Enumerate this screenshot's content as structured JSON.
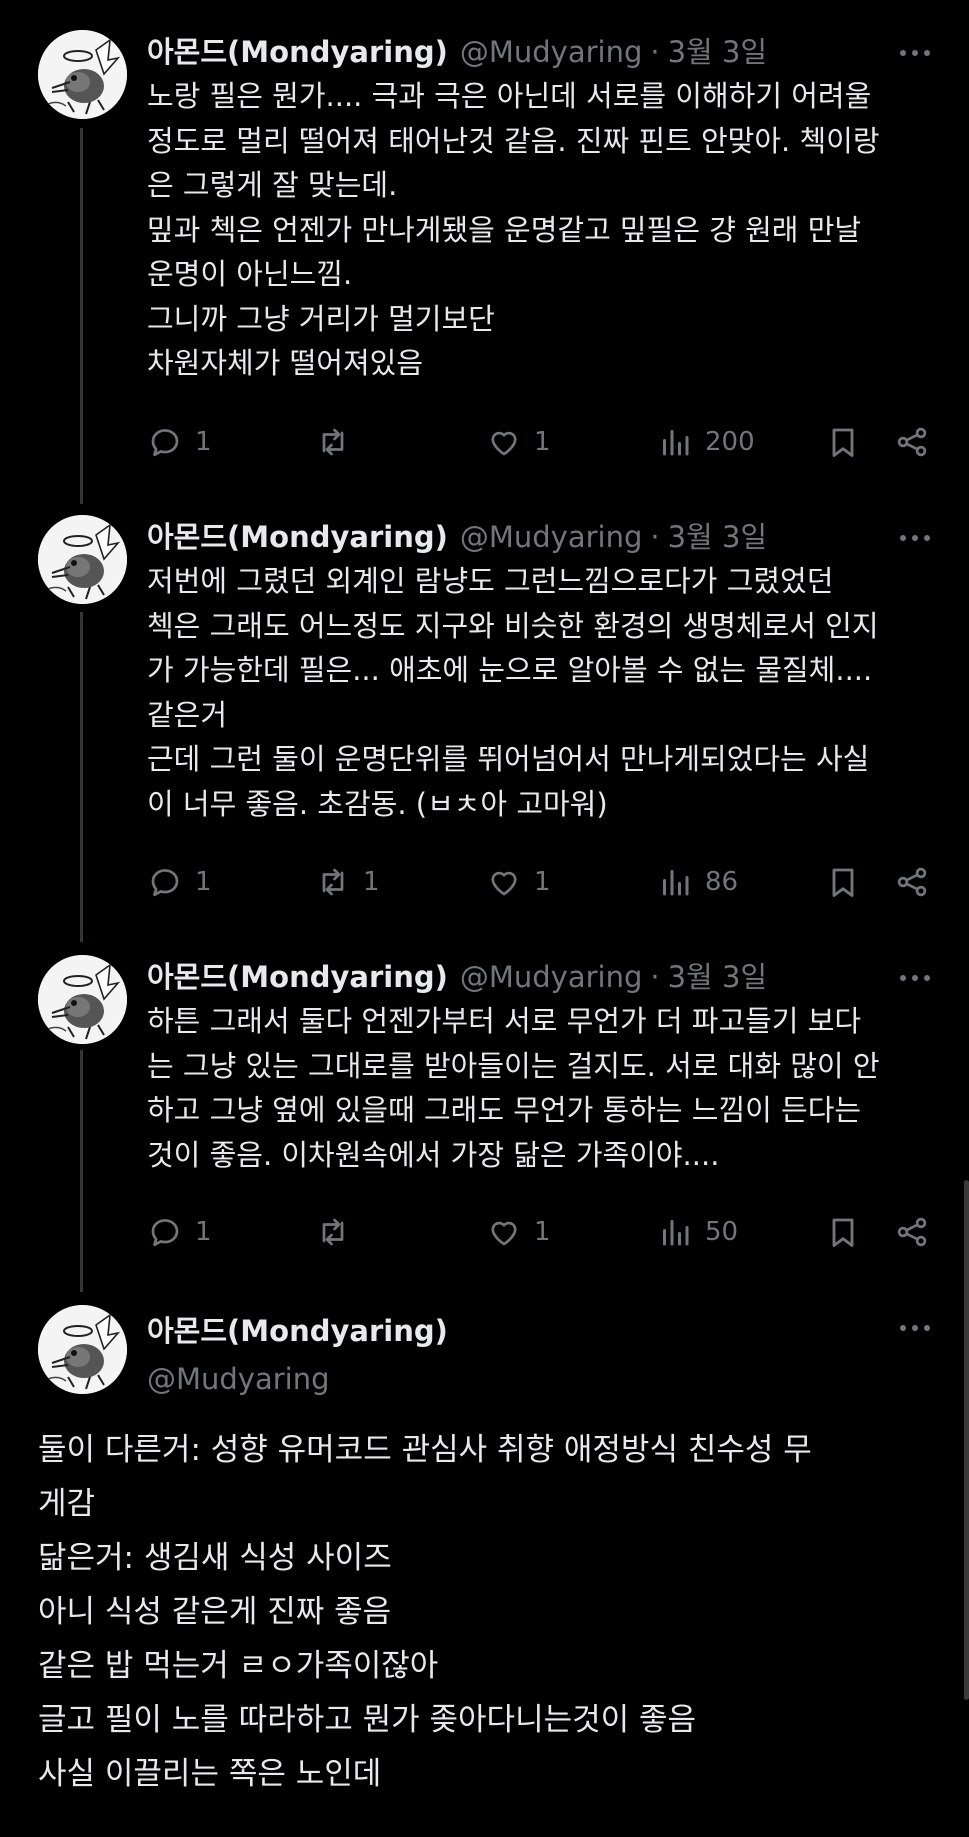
{
  "author": {
    "name": "아몬드(Mondyaring)",
    "handle": "@Mudyaring"
  },
  "tweets": [
    {
      "date": "3월 3일",
      "lines": [
        "노랑 필은 뭔가.... 극과 극은 아닌데 서로를 이해하기 어려울",
        "정도로 멀리 떨어져 태어난것 같음. 진짜 핀트 안맞아. 첵이랑",
        "은 그렇게 잘 맞는데.",
        "밒과 첵은 언젠가 만나게됐을 운명같고 밒필은 걍 원래 만날",
        "운명이 아닌느낌.",
        "그니까 그냥 거리가 멀기보단",
        "차원자체가 떨어져있음"
      ],
      "replies": "1",
      "reposts": "",
      "likes": "1",
      "views": "200"
    },
    {
      "date": "3월 3일",
      "lines": [
        "저번에 그렸던 외계인 람냥도 그런느낌으로다가 그렸었던",
        "첵은 그래도 어느정도 지구와 비슷한 환경의 생명체로서 인지",
        "가 가능한데 필은... 애초에 눈으로 알아볼 수 없는 물질체....",
        "같은거",
        "근데 그런 둘이 운명단위를 뛰어넘어서 만나게되었다는 사실",
        "이 너무 좋음. 초감동. (ㅂㅊ아 고마워)"
      ],
      "replies": "1",
      "reposts": "1",
      "likes": "1",
      "views": "86"
    },
    {
      "date": "3월 3일",
      "lines": [
        "하튼 그래서 둘다 언젠가부터 서로 무언가 더 파고들기 보다",
        "는 그냥 있는 그대로를 받아들이는 걸지도. 서로 대화 많이 안",
        "하고 그냥 옆에 있을때 그래도 무언가 통하는 느낌이 든다는",
        "것이 좋음. 이차원속에서 가장 닮은 가족이야...."
      ],
      "replies": "1",
      "reposts": "",
      "likes": "1",
      "views": "50"
    }
  ],
  "main_tweet": {
    "lines": [
      "둘이 다른거: 성향 유머코드 관심사 취향 애정방식 친수성 무",
      "게감",
      "닮은거: 생김새 식성 사이즈",
      "아니 식성 같은게 진짜 좋음",
      "같은 밥 먹는거 ㄹㅇ가족이잖아",
      "글고 필이 노를 따라하고 뭔가 좆아다니는것이 좋음",
      "사실 이끌리는 쪽은 노인데"
    ]
  },
  "icons": {
    "reply": "reply-icon",
    "repost": "repost-icon",
    "like": "heart-icon",
    "views": "views-icon",
    "bookmark": "bookmark-icon",
    "share": "share-icon",
    "more": "more-icon"
  },
  "colors": {
    "background": "#000000",
    "text": "#e7e9ea",
    "muted": "#71767b",
    "thread_line": "#333639"
  }
}
